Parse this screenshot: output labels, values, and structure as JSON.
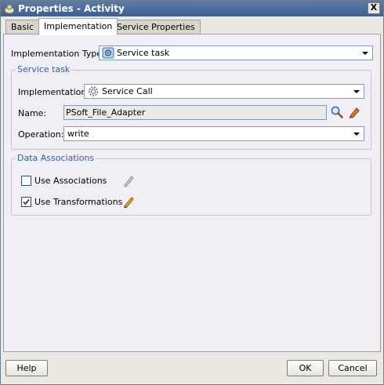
{
  "window": {
    "title": "Properties - Activity",
    "close_label": "X"
  },
  "tabs": [
    {
      "label": "Basic",
      "active": false
    },
    {
      "label": "Implementation",
      "active": true
    },
    {
      "label": "Service Properties",
      "active": false
    }
  ],
  "implementation_type": {
    "label": "Implementation Type:",
    "value": "Service task",
    "icon": "service-task-icon"
  },
  "service_task": {
    "title": "Service task",
    "implementation": {
      "label": "Implementation:",
      "value": "Service Call",
      "icon": "gear-icon"
    },
    "name": {
      "label": "Name:",
      "value": "PSoft_File_Adapter"
    },
    "operation": {
      "label": "Operation:",
      "value": "write"
    }
  },
  "data_associations": {
    "title": "Data Associations",
    "use_associations": {
      "label": "Use Associations",
      "checked": false
    },
    "use_transformations": {
      "label": "Use Transformations",
      "checked": true
    }
  },
  "footer": {
    "help_label": "Help",
    "ok_label": "OK",
    "cancel_label": "Cancel"
  },
  "colors": {
    "titlebar": "#4a6a98",
    "group_title": "#2d5ea8",
    "panel_bg": "#f1eff5"
  }
}
